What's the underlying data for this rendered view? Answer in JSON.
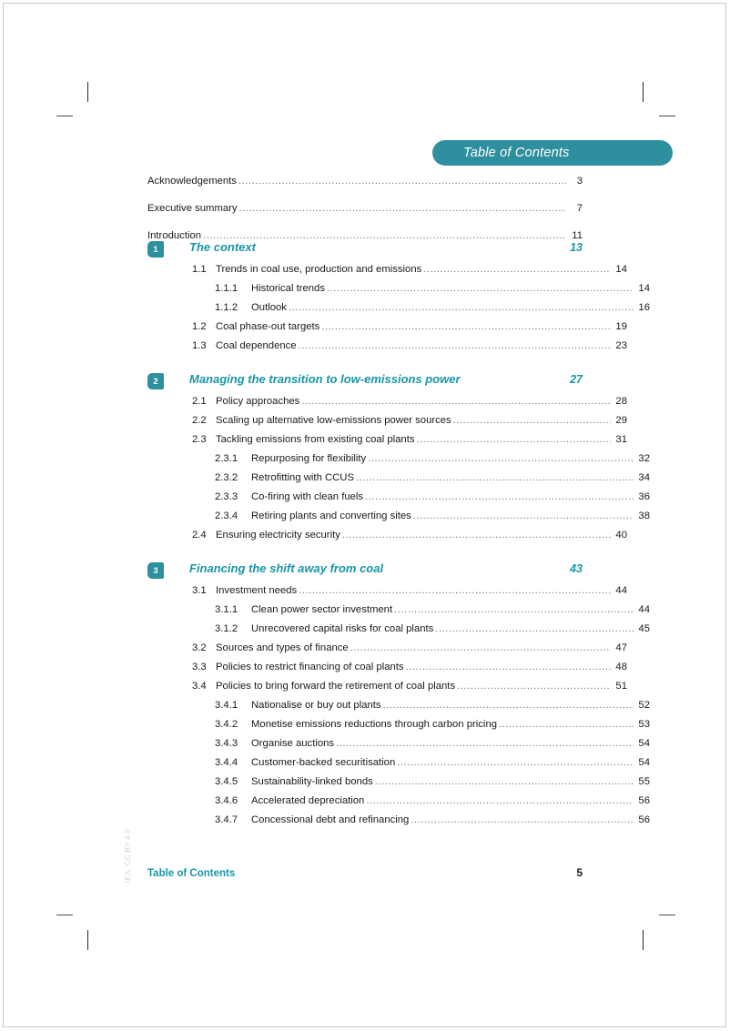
{
  "header": {
    "badge_label": "Table of Contents",
    "badge_color": "#2e8f9e"
  },
  "theme": {
    "teal": "#1896a8",
    "badge_teal": "#2e8f9e",
    "body_text": "#1a1a1a",
    "leader": "#6f6f6f",
    "watermark": "#d2d2d2"
  },
  "front_matter": [
    {
      "label": "Acknowledgements",
      "page": "3"
    },
    {
      "label": "Executive summary",
      "page": "7"
    },
    {
      "label": "Introduction",
      "page": "11"
    }
  ],
  "chapters": [
    {
      "number": "1",
      "title": "The context",
      "page": "13",
      "entries": [
        {
          "level": 2,
          "num": "1.1",
          "label": "Trends in coal use, production and emissions",
          "page": "14"
        },
        {
          "level": 3,
          "num": "1.1.1",
          "label": "Historical trends",
          "page": "14"
        },
        {
          "level": 3,
          "num": "1.1.2",
          "label": "Outlook",
          "page": "16"
        },
        {
          "level": 2,
          "num": "1.2",
          "label": "Coal phase-out targets",
          "page": "19"
        },
        {
          "level": 2,
          "num": "1.3",
          "label": "Coal dependence",
          "page": "23"
        }
      ]
    },
    {
      "number": "2",
      "title": "Managing the transition to low-emissions power",
      "page": "27",
      "entries": [
        {
          "level": 2,
          "num": "2.1",
          "label": "Policy approaches",
          "page": "28"
        },
        {
          "level": 2,
          "num": "2.2",
          "label": "Scaling up alternative low-emissions power sources",
          "page": "29"
        },
        {
          "level": 2,
          "num": "2.3",
          "label": "Tackling emissions from existing coal plants",
          "page": "31"
        },
        {
          "level": 3,
          "num": "2.3.1",
          "label": "Repurposing for flexibility",
          "page": "32"
        },
        {
          "level": 3,
          "num": "2.3.2",
          "label": "Retrofitting with CCUS",
          "page": "34"
        },
        {
          "level": 3,
          "num": "2.3.3",
          "label": "Co-firing with clean fuels",
          "page": "36"
        },
        {
          "level": 3,
          "num": "2.3.4",
          "label": "Retiring plants and converting sites",
          "page": "38"
        },
        {
          "level": 2,
          "num": "2.4",
          "label": "Ensuring electricity security",
          "page": "40"
        }
      ]
    },
    {
      "number": "3",
      "title": "Financing the shift away from coal",
      "page": "43",
      "entries": [
        {
          "level": 2,
          "num": "3.1",
          "label": "Investment needs",
          "page": "44"
        },
        {
          "level": 3,
          "num": "3.1.1",
          "label": "Clean power sector investment",
          "page": "44"
        },
        {
          "level": 3,
          "num": "3.1.2",
          "label": "Unrecovered capital risks for coal plants",
          "page": "45"
        },
        {
          "level": 2,
          "num": "3.2",
          "label": "Sources and types of finance",
          "page": "47"
        },
        {
          "level": 2,
          "num": "3.3",
          "label": "Policies to restrict financing of coal plants",
          "page": "48"
        },
        {
          "level": 2,
          "num": "3.4",
          "label": "Policies to bring forward the retirement of coal plants",
          "page": "51"
        },
        {
          "level": 3,
          "num": "3.4.1",
          "label": "Nationalise or buy out plants",
          "page": "52"
        },
        {
          "level": 3,
          "num": "3.4.2",
          "label": "Monetise emissions reductions through carbon pricing",
          "page": "53"
        },
        {
          "level": 3,
          "num": "3.4.3",
          "label": "Organise auctions",
          "page": "54"
        },
        {
          "level": 3,
          "num": "3.4.4",
          "label": "Customer-backed securitisation",
          "page": "54"
        },
        {
          "level": 3,
          "num": "3.4.5",
          "label": "Sustainability-linked bonds",
          "page": "55"
        },
        {
          "level": 3,
          "num": "3.4.6",
          "label": "Accelerated depreciation",
          "page": "56"
        },
        {
          "level": 3,
          "num": "3.4.7",
          "label": "Concessional debt and refinancing",
          "page": "56"
        }
      ]
    }
  ],
  "footer": {
    "left_label": "Table of Contents",
    "page_number": "5"
  },
  "watermark": {
    "text": "IEA. CC BY 4.0"
  }
}
